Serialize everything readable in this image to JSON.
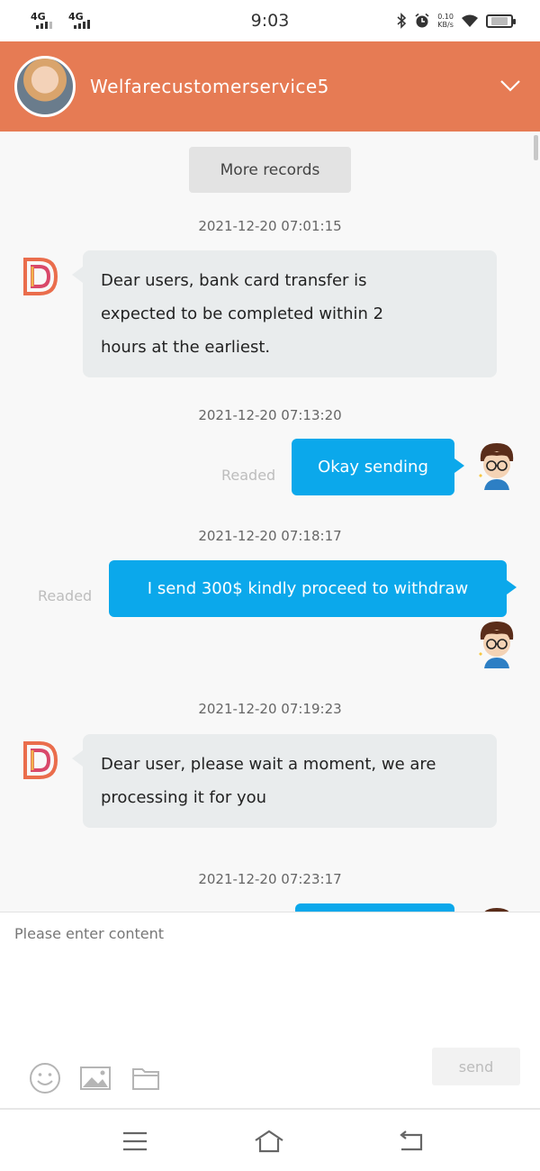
{
  "status_bar": {
    "network1": "4G",
    "network2": "4G",
    "time": "9:03",
    "speed_value": "0.10",
    "speed_unit": "KB/s",
    "icons": [
      "bluetooth-icon",
      "alarm-icon",
      "wifi-icon",
      "battery-icon"
    ]
  },
  "header": {
    "title": "Welfarecustomerservice5",
    "background": "#e67b54",
    "collapse_icon": "chevron-down-icon"
  },
  "chat": {
    "more_records": "More records",
    "messages": [
      {
        "timestamp": "2021-12-20 07:01:15",
        "side": "left",
        "text": "Dear users, bank card transfer is expected to be completed within 2 hours at the earliest.",
        "lines": [
          "Dear users, bank card transfer is",
          "expected to be completed within 2",
          "hours at the earliest."
        ]
      },
      {
        "timestamp": "2021-12-20 07:13:20",
        "side": "right",
        "text": "Okay sending",
        "status": "Readed"
      },
      {
        "timestamp": "2021-12-20 07:18:17",
        "side": "right",
        "text": "I send 300$ kindly proceed to withdraw",
        "status": "Readed"
      },
      {
        "timestamp": "2021-12-20 07:19:23",
        "side": "left",
        "text": "Dear user, please wait a moment, we are processing it for you",
        "lines": [
          "Dear user, please wait a moment, we are",
          "processing it for you"
        ]
      },
      {
        "timestamp": "2021-12-20 07:23:17",
        "side": "right",
        "text": ""
      }
    ],
    "bubble_color_right": "#0ba8eb",
    "bubble_color_left": "#e9eced"
  },
  "composer": {
    "placeholder": "Please enter content",
    "send_label": "send",
    "tools": [
      "emoji-icon",
      "image-icon",
      "folder-icon"
    ]
  },
  "nav": {
    "icons": [
      "menu-icon",
      "home-icon",
      "back-icon"
    ]
  }
}
